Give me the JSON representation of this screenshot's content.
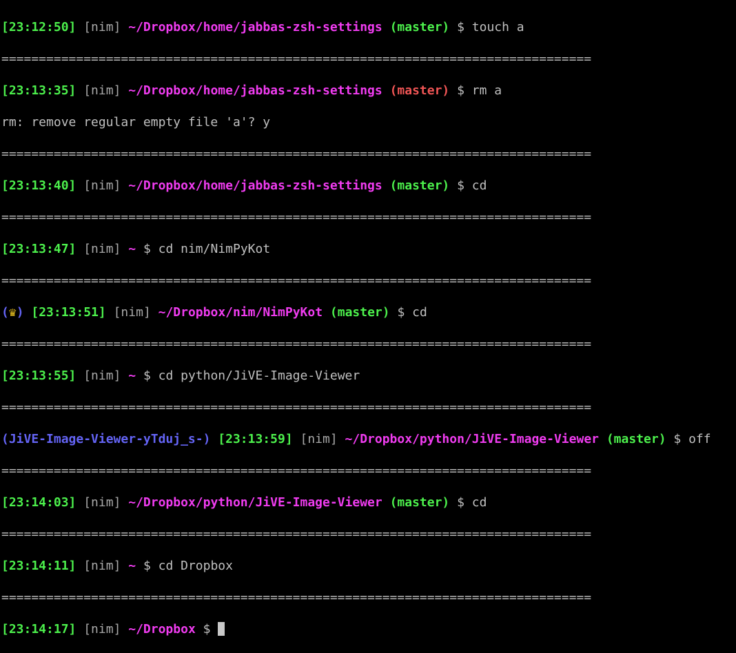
{
  "separator": "===============================================================================",
  "lines": [
    {
      "time": "[23:12:50]",
      "user": "[nim]",
      "path": "~/Dropbox/home/jabbas-zsh-settings",
      "branch": "(master)",
      "branch_state": "clean",
      "cmd": "$ touch a"
    },
    {
      "time": "[23:13:35]",
      "user": "[nim]",
      "path": "~/Dropbox/home/jabbas-zsh-settings",
      "branch": "(master)",
      "branch_state": "dirty",
      "cmd": "$ rm a",
      "output": "rm: remove regular empty file 'a'? y"
    },
    {
      "time": "[23:13:40]",
      "user": "[nim]",
      "path": "~/Dropbox/home/jabbas-zsh-settings",
      "branch": "(master)",
      "cmd": "$ cd"
    },
    {
      "time": "[23:13:47]",
      "user": "[nim]",
      "path": "~",
      "cmd": "$ cd nim/NimPyKot"
    },
    {
      "prefix_open": "(",
      "prefix_icon": "♛",
      "prefix_close": ")",
      "time": "[23:13:51]",
      "user": "[nim]",
      "path": "~/Dropbox/nim/NimPyKot",
      "branch": "(master)",
      "cmd": "$ cd"
    },
    {
      "time": "[23:13:55]",
      "user": "[nim]",
      "path": "~",
      "cmd": "$ cd python/JiVE-Image-Viewer"
    },
    {
      "venv": "(JiVE-Image-Viewer-yTduj_s-)",
      "time": "[23:13:59]",
      "user": "[nim]",
      "path": "~/Dropbox/python/JiVE-Image-Viewer",
      "branch": "(master)",
      "cmd": "$ off"
    },
    {
      "time": "[23:14:03]",
      "user": "[nim]",
      "path": "~/Dropbox/python/JiVE-Image-Viewer",
      "branch": "(master)",
      "cmd": "$ cd"
    },
    {
      "time": "[23:14:11]",
      "user": "[nim]",
      "path": "~",
      "cmd": "$ cd Dropbox"
    },
    {
      "time": "[23:14:17]",
      "user": "[nim]",
      "path": "~/Dropbox",
      "cmd": "$ "
    }
  ]
}
